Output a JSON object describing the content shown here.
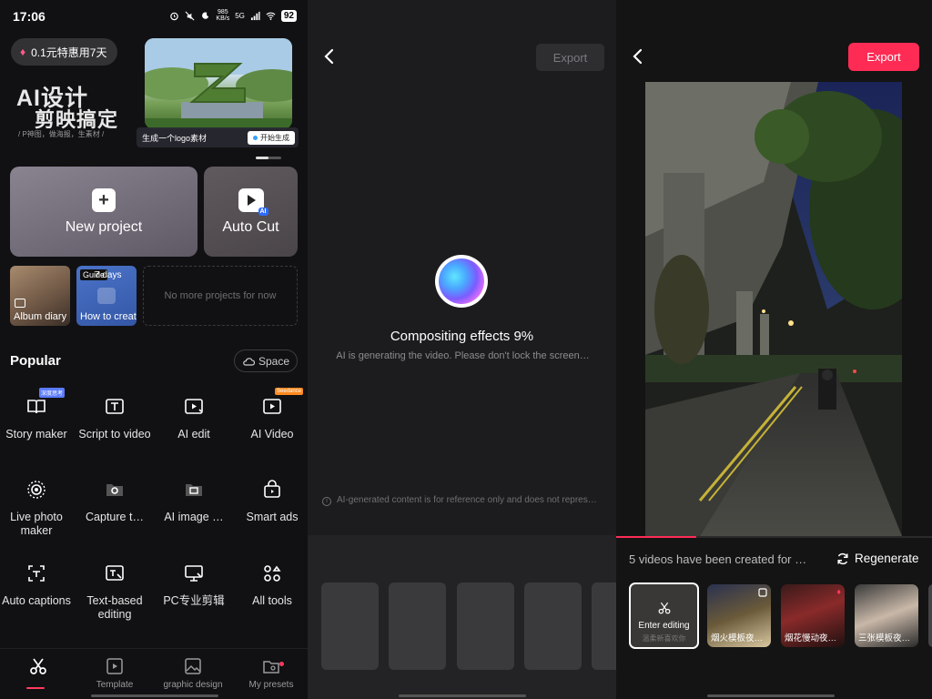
{
  "status_bar": {
    "time": "17:06",
    "network": "985\nKB/s",
    "signal": "5G",
    "battery": "92"
  },
  "panel_home": {
    "promo": {
      "label": "0.1元特惠用7天"
    },
    "banner": {
      "title_line1": "AI设计",
      "title_line2": "剪映搞定",
      "subtitle": "/ P神图，做海报，生素材 /",
      "caption": "生成一个logo素材",
      "caption_button": "开始生成"
    },
    "new_project": {
      "label": "New project"
    },
    "auto_cut": {
      "label": "Auto Cut",
      "badge": "AI"
    },
    "drafts": [
      {
        "label": "Album diary"
      },
      {
        "label": "How to create",
        "badge": "Guide",
        "days": "7 days"
      }
    ],
    "no_more": "No more projects for now",
    "popular": {
      "title": "Popular",
      "space_label": "Space"
    },
    "tools": [
      {
        "label": "Story maker",
        "tag": "深度思考",
        "icon": "book-icon"
      },
      {
        "label": "Script to video",
        "icon": "script-icon"
      },
      {
        "label": "AI edit",
        "icon": "ai-edit-icon"
      },
      {
        "label": "AI Video",
        "tag": "Seedance",
        "icon": "ai-video-icon"
      },
      {
        "label": "Live photo maker",
        "icon": "live-photo-icon"
      },
      {
        "label": "Capture t…",
        "icon": "capture-icon"
      },
      {
        "label": "AI image …",
        "icon": "ai-image-icon"
      },
      {
        "label": "Smart ads",
        "icon": "bag-icon"
      },
      {
        "label": "Auto captions",
        "icon": "captions-icon"
      },
      {
        "label": "Text-based editing",
        "icon": "text-edit-icon"
      },
      {
        "label": "PC专业剪辑",
        "icon": "pc-icon"
      },
      {
        "label": "All tools",
        "icon": "grid-icon"
      }
    ],
    "bottom_nav": [
      {
        "label": "",
        "icon": "scissors-icon"
      },
      {
        "label": "Template",
        "icon": "template-icon"
      },
      {
        "label": "graphic design",
        "icon": "image-icon"
      },
      {
        "label": "My presets",
        "icon": "presets-icon"
      }
    ]
  },
  "panel_compositing": {
    "export_label": "Export",
    "title": "Compositing effects 9%",
    "subtitle": "AI is generating the video. Please don't lock the screen…",
    "disclaimer": "AI-generated content is for reference only and does not repres…",
    "progress_percent": 9
  },
  "panel_result": {
    "export_label": "Export",
    "created_text": "5 videos have been created for …",
    "regenerate_label": "Regenerate",
    "playback_progress": 0.25,
    "thumbnails": [
      {
        "label": "Enter editing",
        "faded": "温柔新喜欢你"
      },
      {
        "label": "烟火模板夜…"
      },
      {
        "label": "烟花慢动夜…"
      },
      {
        "label": "三张模板夜…"
      }
    ]
  }
}
